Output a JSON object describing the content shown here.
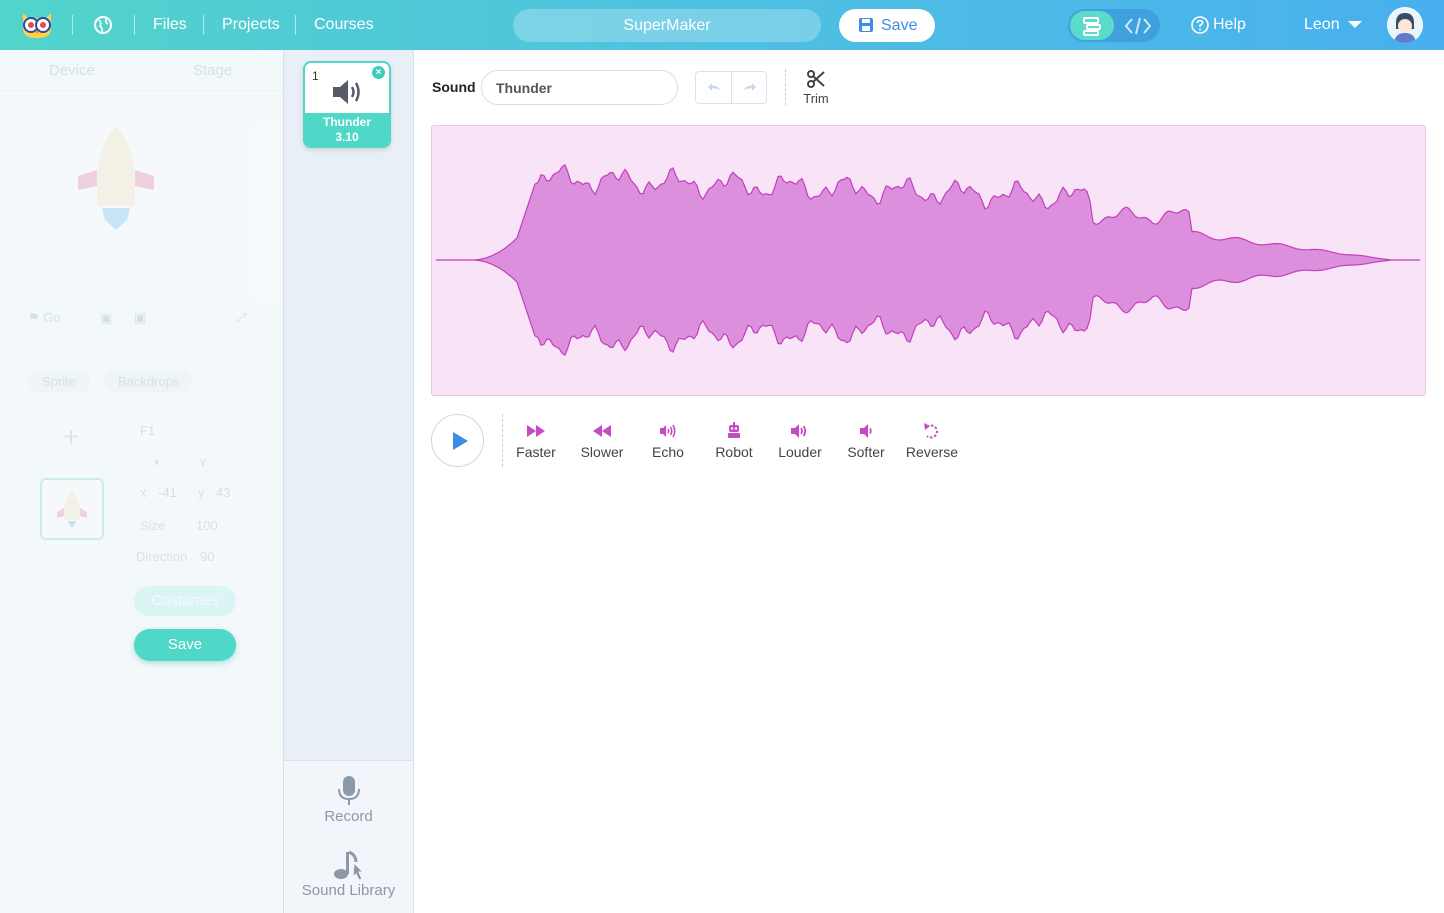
{
  "topbar": {
    "nav": [
      "Files",
      "Projects",
      "Courses"
    ],
    "project_name": "SuperMaker",
    "save_label": "Save",
    "help_label": "Help",
    "user_name": "Leon"
  },
  "left_panel": {
    "tabs": [
      "Device",
      "Stage"
    ],
    "go_label": "Go",
    "sprite_tabs": [
      "Sprite",
      "Backdrops"
    ],
    "sprite_name": "F1",
    "x_label": "x",
    "x_value": "-41",
    "y_label": "y",
    "y_value": "43",
    "size_label": "Size",
    "size_value": "100",
    "direction_label": "Direction",
    "direction_value": "90",
    "costumes_label": "Costumes",
    "save_label": "Save"
  },
  "sound_list": {
    "items": [
      {
        "number": "1",
        "name": "Thunder",
        "duration": "3.10"
      }
    ],
    "record_label": "Record",
    "library_label": "Sound Library"
  },
  "editor": {
    "sound_label": "Sound",
    "sound_name": "Thunder",
    "trim_label": "Trim",
    "waveform_fill": "#dc8fdd",
    "waveform_stroke": "#c23fbf",
    "effect_color": "#c44bc6",
    "effects": [
      "Faster",
      "Slower",
      "Echo",
      "Robot",
      "Louder",
      "Softer",
      "Reverse"
    ]
  }
}
